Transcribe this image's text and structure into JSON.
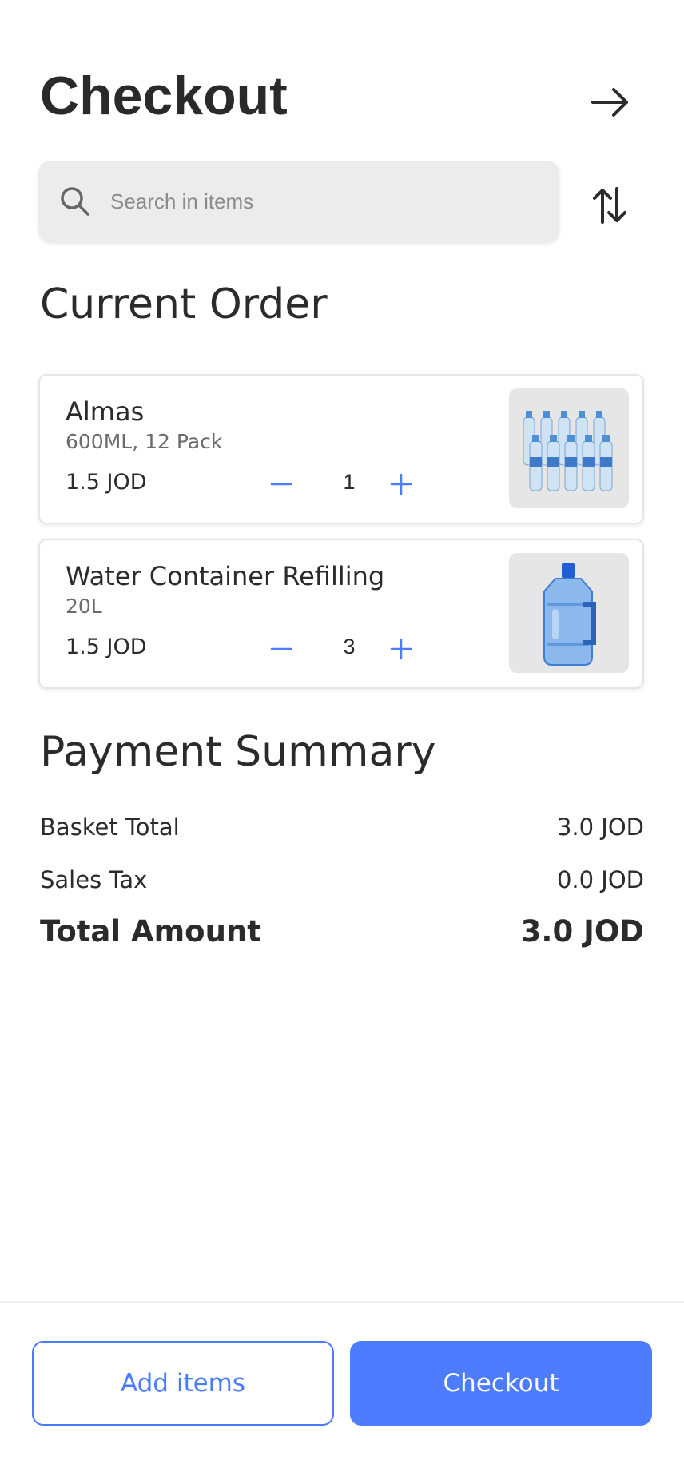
{
  "header": {
    "title": "Checkout"
  },
  "search": {
    "placeholder": "Search in items",
    "value": ""
  },
  "current_order": {
    "title": "Current Order",
    "items": [
      {
        "name": "Almas",
        "description": "600ML, 12 Pack",
        "price": "1.5 JOD",
        "quantity": "1"
      },
      {
        "name": "Water Container Refilling",
        "description": "20L",
        "price": "1.5 JOD",
        "quantity": "3"
      }
    ]
  },
  "payment_summary": {
    "title": "Payment Summary",
    "basket_total_label": "Basket Total",
    "basket_total_value": "3.0 JOD",
    "sales_tax_label": "Sales Tax",
    "sales_tax_value": "0.0 JOD",
    "total_label": "Total Amount",
    "total_value": "3.0 JOD"
  },
  "actions": {
    "add_items_label": "Add items",
    "checkout_label": "Checkout"
  },
  "colors": {
    "accent": "#4d7cff",
    "text": "#2b2b2b",
    "muted": "#6b6b6b",
    "input_bg": "#ececec"
  },
  "icons": [
    "arrow-right-icon",
    "search-icon",
    "sort-icon",
    "minus-icon",
    "plus-icon"
  ]
}
